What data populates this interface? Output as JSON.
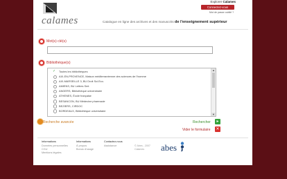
{
  "header": {
    "logo_text": "calames",
    "tagline_prefix": "Catalogue en ligne des archives et des manuscrits",
    "tagline_bold": "de l'enseignement supérieur",
    "explorer_label": "Explorer",
    "explorer_bold": "Calames",
    "connect_button": "Connectez-vous",
    "lost_password": "Mot de passe oublié ?"
  },
  "form": {
    "keywords_label": "Mot(s) clé(s)",
    "keywords_value": "",
    "libraries_label": "Bibliothèque(s)",
    "libraries": [
      {
        "label": "Toutes les bibliothèques",
        "checked": true
      },
      {
        "label": "AIX-EN-PROVENCE, Maison méditerranéenne des sciences de l'homme",
        "checked": false
      },
      {
        "label": "AIX-MARSEILLE 3, BU Droit Sci.Eco.",
        "checked": false
      },
      {
        "label": "AMIENS, BU Lettres Smt",
        "checked": false
      },
      {
        "label": "ANGERS, Bibliothèque universitaire",
        "checked": false
      },
      {
        "label": "ATHENES, École française",
        "checked": false
      },
      {
        "label": "BESANCON, BU Médecine pharmacie",
        "checked": false
      },
      {
        "label": "BEZIERS, CIRDOC",
        "checked": false
      },
      {
        "label": "BORDEAUX, Bibliothèque universitaire",
        "checked": false
      }
    ],
    "advanced_search": "Recherche avancée",
    "search_label": "Rechercher",
    "clear_label": "Vider le formulaire"
  },
  "footer": {
    "col1": {
      "heading": "Informations",
      "links": [
        "Données personnelles",
        "CGU",
        "Mentions légales"
      ]
    },
    "col2": {
      "heading": "Informations",
      "links": [
        "À propos",
        "Bonus d'usage"
      ]
    },
    "col3": {
      "heading": "Contactez-nous",
      "links": [
        "Assistance"
      ]
    },
    "copyright": [
      "© Abes - 2007",
      "Calames"
    ],
    "abes_logo": "abes"
  },
  "colors": {
    "background": "#5b0f15",
    "accent_red": "#d8322e",
    "search_green": "#35a33b",
    "advanced_orange": "#e38a1e",
    "abes_blue": "#1e3e6e"
  }
}
